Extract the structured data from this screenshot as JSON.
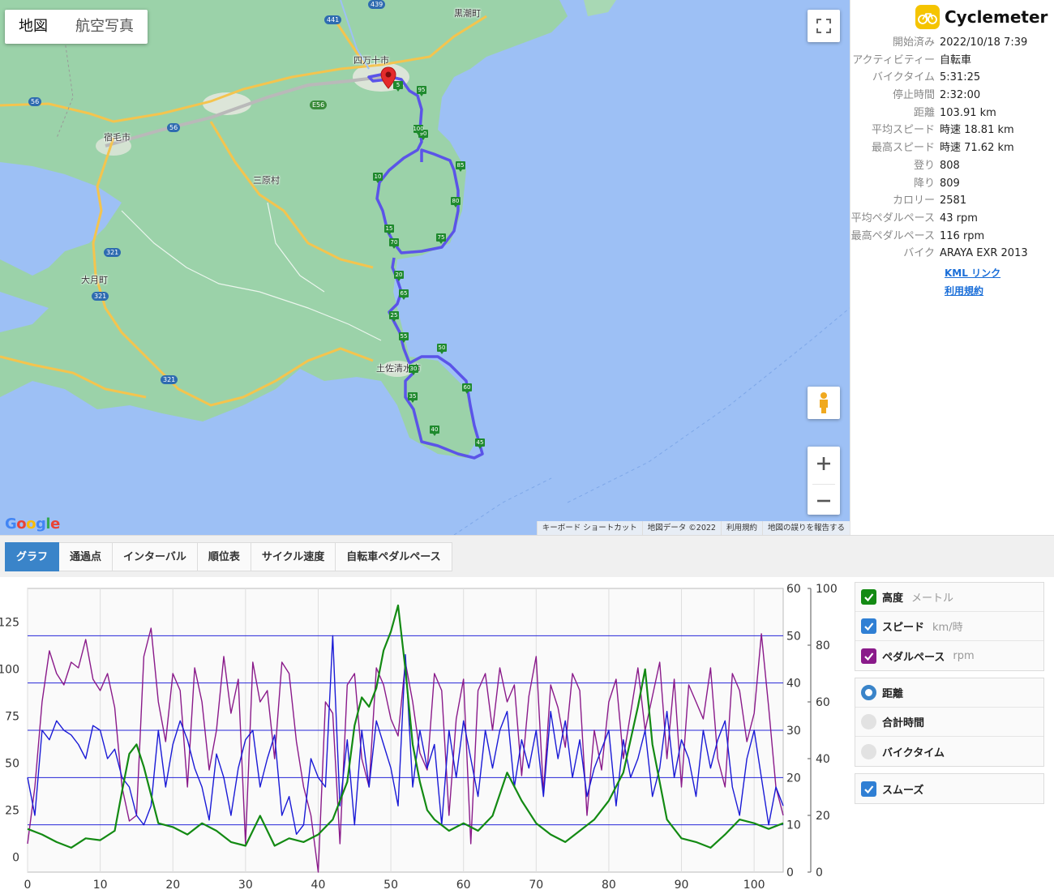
{
  "map": {
    "type_buttons": [
      "地図",
      "航空写真"
    ],
    "places": [
      "四万十市",
      "黒潮町",
      "宿毛市",
      "三原村",
      "大月町",
      "土佐清水市"
    ],
    "route_shields": [
      "441",
      "439",
      "56",
      "56",
      "E56",
      "321",
      "321",
      "321"
    ],
    "km_markers": [
      "5",
      "10",
      "15",
      "20",
      "25",
      "30",
      "35",
      "40",
      "45",
      "50",
      "55",
      "60",
      "65",
      "70",
      "75",
      "80",
      "85",
      "90",
      "95",
      "100"
    ],
    "google_logo": "Google",
    "attribution": [
      "キーボード ショートカット",
      "地図データ ©2022",
      "利用規約",
      "地図の誤りを報告する"
    ],
    "icons": {
      "fullscreen": "fullscreen-icon",
      "pegman": "pegman-icon",
      "zoom_in": "plus-icon",
      "zoom_out": "minus-icon",
      "pin": "location-pin-icon"
    }
  },
  "info": {
    "app_name": "Cyclemeter",
    "stats": [
      {
        "label": "開始済み",
        "value": "2022/10/18 7:39"
      },
      {
        "label": "アクティビティー",
        "value": "自転車"
      },
      {
        "label": "バイクタイム",
        "value": "5:31:25"
      },
      {
        "label": "停止時間",
        "value": "2:32:00"
      },
      {
        "label": "距離",
        "value": "103.91 km"
      },
      {
        "label": "平均スピード",
        "value": "時速 18.81 km"
      },
      {
        "label": "最高スピード",
        "value": "時速 71.62 km"
      },
      {
        "label": "登り",
        "value": "808"
      },
      {
        "label": "降り",
        "value": "809"
      },
      {
        "label": "カロリー",
        "value": "2581"
      },
      {
        "label": "平均ペダルペース",
        "value": "43 rpm"
      },
      {
        "label": "最高ペダルペース",
        "value": "116 rpm"
      },
      {
        "label": "バイク",
        "value": "ARAYA EXR 2013"
      }
    ],
    "links": [
      "KML リンク",
      "利用規約"
    ]
  },
  "tabs": [
    {
      "label": "グラフ",
      "active": true
    },
    {
      "label": "通過点",
      "active": false
    },
    {
      "label": "インターバル",
      "active": false
    },
    {
      "label": "順位表",
      "active": false
    },
    {
      "label": "サイクル速度",
      "active": false
    },
    {
      "label": "自転車ペダルペース",
      "active": false
    }
  ],
  "legend": {
    "series": [
      {
        "name": "高度",
        "unit": "メートル",
        "color": "#138a13",
        "checked": true
      },
      {
        "name": "スピード",
        "unit": "km/時",
        "color": "#2f7fd4",
        "checked": true
      },
      {
        "name": "ペダルペース",
        "unit": "rpm",
        "color": "#8a1a8a",
        "checked": true
      }
    ],
    "axis_modes": [
      {
        "name": "距離",
        "selected": true
      },
      {
        "name": "合計時間",
        "selected": false
      },
      {
        "name": "バイクタイム",
        "selected": false
      }
    ],
    "smooth": {
      "name": "スムーズ",
      "checked": true
    }
  },
  "chart_data": {
    "type": "line",
    "x_range": [
      0,
      104
    ],
    "x_ticks": [
      0,
      10,
      20,
      30,
      40,
      50,
      60,
      70,
      80,
      90,
      100
    ],
    "y_axes": {
      "altitude": {
        "range": [
          -8,
          143
        ],
        "ticks": [
          0,
          25,
          50,
          75,
          100,
          125
        ]
      },
      "speed": {
        "range": [
          0,
          60
        ],
        "ticks": [
          0,
          10,
          20,
          30,
          40,
          50,
          60
        ]
      },
      "cadence": {
        "range": [
          0,
          100
        ],
        "ticks": [
          0,
          20,
          40,
          60,
          80,
          100
        ]
      }
    },
    "series": [
      {
        "key": "altitude",
        "name": "高度",
        "color": "#138a13",
        "x": [
          0,
          2,
          4,
          6,
          8,
          10,
          12,
          13,
          14,
          15,
          16,
          18,
          20,
          22,
          24,
          26,
          28,
          30,
          32,
          34,
          36,
          38,
          40,
          42,
          44,
          45,
          46,
          47,
          48,
          49,
          50,
          51,
          52,
          53,
          54,
          55,
          56,
          58,
          60,
          62,
          64,
          66,
          68,
          70,
          72,
          74,
          76,
          78,
          80,
          82,
          84,
          85,
          86,
          88,
          90,
          92,
          94,
          96,
          98,
          100,
          102,
          104
        ],
        "y": [
          15,
          12,
          8,
          5,
          10,
          9,
          14,
          35,
          55,
          60,
          48,
          18,
          16,
          12,
          18,
          14,
          8,
          6,
          22,
          6,
          10,
          8,
          12,
          20,
          40,
          70,
          85,
          80,
          90,
          110,
          120,
          134,
          100,
          60,
          40,
          25,
          20,
          14,
          18,
          14,
          22,
          45,
          30,
          18,
          12,
          8,
          14,
          20,
          30,
          45,
          80,
          100,
          60,
          20,
          10,
          8,
          5,
          12,
          20,
          18,
          15,
          18
        ]
      },
      {
        "key": "speed",
        "name": "スピード",
        "color": "#1a1ad6",
        "x": [
          0,
          1,
          2,
          3,
          4,
          5,
          6,
          7,
          8,
          9,
          10,
          11,
          12,
          13,
          14,
          15,
          16,
          17,
          18,
          19,
          20,
          21,
          22,
          23,
          24,
          25,
          26,
          27,
          28,
          29,
          30,
          31,
          32,
          33,
          34,
          35,
          36,
          37,
          38,
          39,
          40,
          41,
          42,
          43,
          44,
          45,
          46,
          47,
          48,
          49,
          50,
          51,
          52,
          53,
          54,
          55,
          56,
          57,
          58,
          59,
          60,
          61,
          62,
          63,
          64,
          65,
          66,
          67,
          68,
          69,
          70,
          71,
          72,
          73,
          74,
          75,
          76,
          77,
          78,
          79,
          80,
          81,
          82,
          83,
          84,
          85,
          86,
          87,
          88,
          89,
          90,
          91,
          92,
          93,
          94,
          95,
          96,
          97,
          98,
          99,
          100,
          101,
          102,
          103,
          104
        ],
        "y": [
          20,
          12,
          30,
          28,
          32,
          30,
          29,
          27,
          24,
          31,
          30,
          24,
          26,
          20,
          18,
          12,
          10,
          14,
          30,
          18,
          27,
          32,
          28,
          22,
          18,
          11,
          25,
          20,
          12,
          22,
          28,
          30,
          18,
          24,
          29,
          12,
          16,
          8,
          10,
          24,
          20,
          18,
          50,
          14,
          28,
          10,
          30,
          18,
          32,
          27,
          22,
          14,
          46,
          18,
          30,
          22,
          27,
          10,
          30,
          20,
          32,
          24,
          16,
          30,
          22,
          30,
          34,
          18,
          28,
          22,
          30,
          16,
          34,
          24,
          32,
          20,
          28,
          16,
          22,
          26,
          30,
          14,
          28,
          20,
          24,
          30,
          16,
          22,
          34,
          20,
          28,
          24,
          16,
          30,
          22,
          28,
          32,
          18,
          12,
          24,
          30,
          20,
          10,
          18,
          14
        ]
      },
      {
        "key": "cadence",
        "name": "ペダルペース",
        "color": "#8a1a8a",
        "x": [
          0,
          1,
          2,
          3,
          4,
          5,
          6,
          7,
          8,
          9,
          10,
          11,
          12,
          13,
          14,
          15,
          16,
          17,
          18,
          19,
          20,
          21,
          22,
          23,
          24,
          25,
          26,
          27,
          28,
          29,
          30,
          31,
          32,
          33,
          34,
          35,
          36,
          37,
          38,
          39,
          40,
          41,
          42,
          43,
          44,
          45,
          46,
          47,
          48,
          49,
          50,
          51,
          52,
          53,
          54,
          55,
          56,
          57,
          58,
          59,
          60,
          61,
          62,
          63,
          64,
          65,
          66,
          67,
          68,
          69,
          70,
          71,
          72,
          73,
          74,
          75,
          76,
          77,
          78,
          79,
          80,
          81,
          82,
          83,
          84,
          85,
          86,
          87,
          88,
          89,
          90,
          91,
          92,
          93,
          94,
          95,
          96,
          97,
          98,
          99,
          100,
          101,
          102,
          103,
          104
        ],
        "y": [
          10,
          30,
          60,
          78,
          70,
          66,
          74,
          72,
          82,
          68,
          64,
          70,
          58,
          30,
          18,
          20,
          76,
          86,
          60,
          46,
          70,
          64,
          30,
          72,
          60,
          36,
          50,
          76,
          56,
          68,
          10,
          74,
          60,
          64,
          40,
          74,
          70,
          46,
          30,
          20,
          0,
          60,
          56,
          10,
          66,
          70,
          40,
          30,
          72,
          66,
          54,
          48,
          74,
          60,
          42,
          36,
          70,
          64,
          20,
          54,
          68,
          10,
          64,
          70,
          50,
          72,
          60,
          66,
          34,
          62,
          76,
          28,
          66,
          58,
          44,
          70,
          64,
          20,
          50,
          36,
          60,
          68,
          40,
          56,
          72,
          50,
          62,
          74,
          40,
          68,
          30,
          66,
          60,
          54,
          72,
          40,
          30,
          70,
          64,
          46,
          56,
          84,
          58,
          30,
          20
        ]
      }
    ]
  }
}
